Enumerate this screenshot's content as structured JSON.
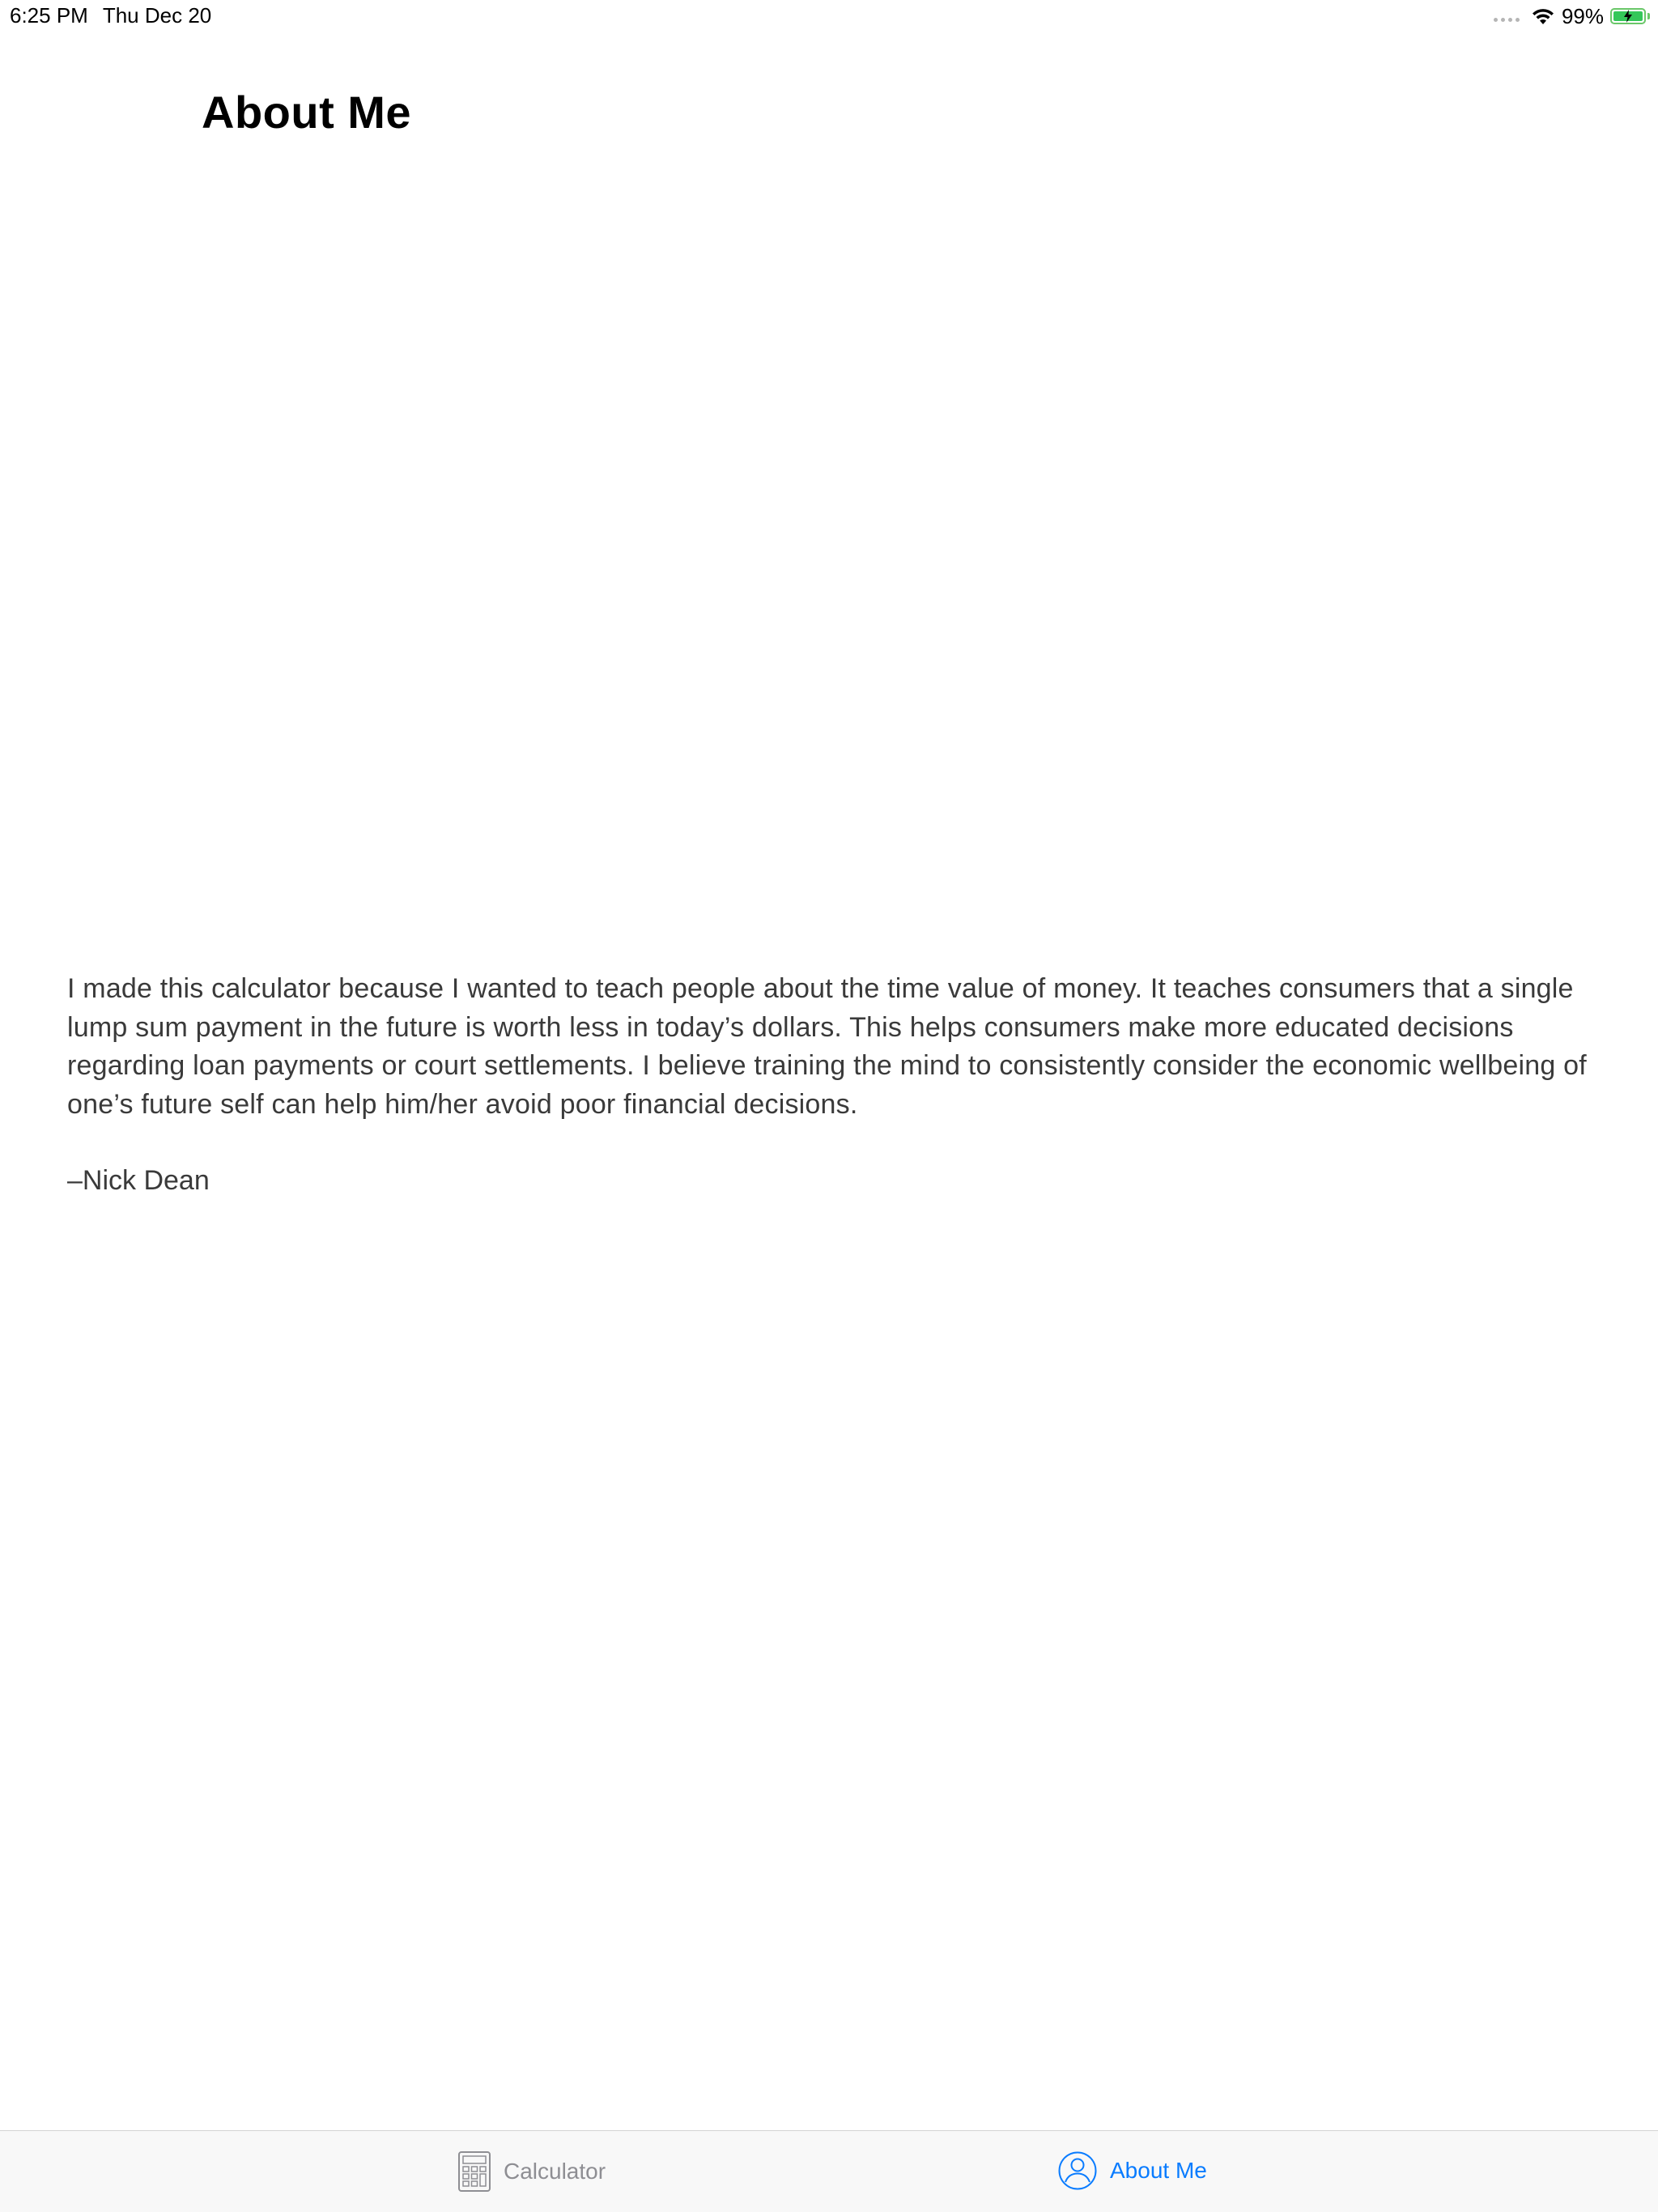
{
  "status_bar": {
    "time": "6:25 PM",
    "date": "Thu Dec 20",
    "battery_percent": "99%",
    "battery_level": 0.99,
    "battery_color": "#34c759",
    "charging": true,
    "wifi_icon": "wifi-icon",
    "signal_icon": "cellular-dots-icon"
  },
  "header": {
    "title": "About Me"
  },
  "main": {
    "paragraph": "I made this calculator because I wanted to teach people about the time value of money.  It teaches consumers that a single lump sum payment in the future is worth less in today’s dollars. This helps consumers make more educated decisions regarding loan payments or court settlements. I believe training the mind to consistently consider the  economic wellbeing of one’s future self can help him/her avoid poor financial decisions.",
    "signature": "–Nick Dean"
  },
  "tab_bar": {
    "tabs": [
      {
        "label": "Calculator",
        "icon": "calculator-icon",
        "selected": false
      },
      {
        "label": "About Me",
        "icon": "person-icon",
        "selected": true
      }
    ],
    "selected_color": "#0a7cff",
    "unselected_color": "#8e8e93"
  }
}
